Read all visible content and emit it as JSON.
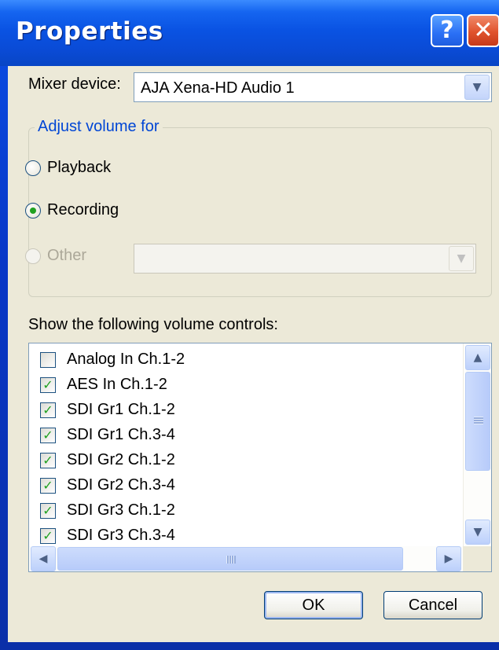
{
  "window": {
    "title": "Properties",
    "help_label": "?",
    "close_label": "✕"
  },
  "mixer": {
    "label": "Mixer device:",
    "value": "AJA Xena-HD Audio 1"
  },
  "adjust": {
    "group_title": "Adjust volume for",
    "options": [
      {
        "label": "Playback",
        "selected": false,
        "enabled": true
      },
      {
        "label": "Recording",
        "selected": true,
        "enabled": true
      },
      {
        "label": "Other",
        "selected": false,
        "enabled": false
      }
    ],
    "other_value": ""
  },
  "controls": {
    "label": "Show the following volume controls:",
    "items": [
      {
        "label": "Analog In Ch.1-2",
        "checked": false
      },
      {
        "label": "AES In Ch.1-2",
        "checked": true
      },
      {
        "label": "SDI Gr1 Ch.1-2",
        "checked": true
      },
      {
        "label": "SDI Gr1 Ch.3-4",
        "checked": true
      },
      {
        "label": "SDI Gr2 Ch.1-2",
        "checked": true
      },
      {
        "label": "SDI Gr2 Ch.3-4",
        "checked": true
      },
      {
        "label": "SDI Gr3 Ch.1-2",
        "checked": true
      },
      {
        "label": "SDI Gr3 Ch.3-4",
        "checked": true
      }
    ]
  },
  "buttons": {
    "ok": "OK",
    "cancel": "Cancel"
  },
  "icons": {
    "combo_arrow": "chevron-down-icon",
    "scroll_up": "chevron-up-icon",
    "scroll_down": "chevron-down-icon",
    "scroll_left": "chevron-left-icon",
    "scroll_right": "chevron-right-icon"
  },
  "colors": {
    "title_bar": "#0a53e3",
    "dialog_bg": "#ece9d8",
    "group_title": "#0046d5",
    "check_green": "#21a121",
    "close_red": "#e0532d"
  }
}
